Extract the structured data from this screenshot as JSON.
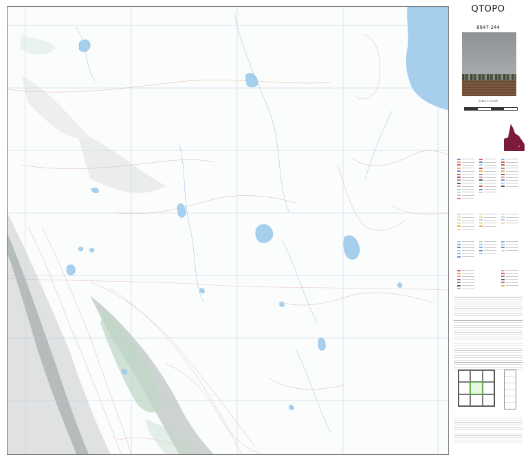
{
  "panel": {
    "brand": "QTOPO",
    "sheet_id": "8647-244",
    "scale": "SCALE 1:10,000"
  },
  "colors": {
    "water": "#a6cfee",
    "vegetation": "#bfd9c7",
    "contour": "#c8a48a",
    "grid": "#b7cfe6",
    "road": "#d9a2a2",
    "queensland": "#7b1a3b",
    "frame": "#7a7a7a"
  }
}
